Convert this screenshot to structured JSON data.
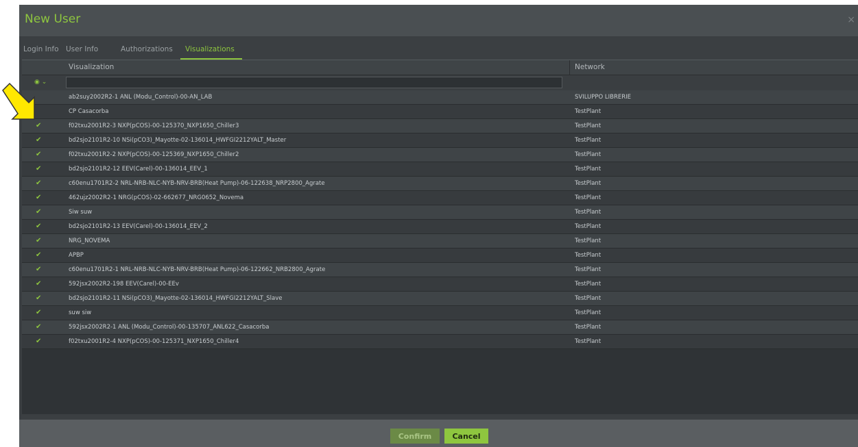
{
  "dialog": {
    "title": "New User"
  },
  "tabs": [
    {
      "label": "Login Info"
    },
    {
      "label": "User Info"
    },
    {
      "label": "Authorizations"
    },
    {
      "label": "Visualizations"
    }
  ],
  "grid": {
    "columns": {
      "visualization": "Visualization",
      "network": "Network"
    },
    "filter": {
      "value": ""
    },
    "rows": [
      {
        "checked": false,
        "visualization": "ab2suy2002R2-1 ANL (Modu_Control)-00-AN_LAB",
        "network": "SVILUPPO LIBRERIE"
      },
      {
        "checked": false,
        "visualization": "CP Casacorba",
        "network": "TestPlant"
      },
      {
        "checked": true,
        "visualization": "f02txu2001R2-3 NXP(pCOS)-00-125370_NXP1650_Chiller3",
        "network": "TestPlant"
      },
      {
        "checked": true,
        "visualization": "bd2sjo2101R2-10 NSi(pCO3)_Mayotte-02-136014_HWFGI2212YALT_Master",
        "network": "TestPlant"
      },
      {
        "checked": true,
        "visualization": "f02txu2001R2-2 NXP(pCOS)-00-125369_NXP1650_Chiller2",
        "network": "TestPlant"
      },
      {
        "checked": true,
        "visualization": "bd2sjo2101R2-12 EEV(Carel)-00-136014_EEV_1",
        "network": "TestPlant"
      },
      {
        "checked": true,
        "visualization": "c60enu1701R2-2 NRL-NRB-NLC-NYB-NRV-BRB(Heat Pump)-06-122638_NRP2800_Agrate",
        "network": "TestPlant"
      },
      {
        "checked": true,
        "visualization": "462ujz2002R2-1 NRG(pCOS)-02-662677_NRG0652_Novema",
        "network": "TestPlant"
      },
      {
        "checked": true,
        "visualization": "Siw suw",
        "network": "TestPlant"
      },
      {
        "checked": true,
        "visualization": "bd2sjo2101R2-13 EEV(Carel)-00-136014_EEV_2",
        "network": "TestPlant"
      },
      {
        "checked": true,
        "visualization": "NRG_NOVEMA",
        "network": "TestPlant"
      },
      {
        "checked": true,
        "visualization": "APBP",
        "network": "TestPlant"
      },
      {
        "checked": true,
        "visualization": "c60enu1701R2-1 NRL-NRB-NLC-NYB-NRV-BRB(Heat Pump)-06-122662_NRB2800_Agrate",
        "network": "TestPlant"
      },
      {
        "checked": true,
        "visualization": "592jsx2002R2-198 EEV(Carel)-00-EEv",
        "network": "TestPlant"
      },
      {
        "checked": true,
        "visualization": "bd2sjo2101R2-11 NSi(pCO3)_Mayotte-02-136014_HWFGI2212YALT_Slave",
        "network": "TestPlant"
      },
      {
        "checked": true,
        "visualization": "suw siw",
        "network": "TestPlant"
      },
      {
        "checked": true,
        "visualization": "592jsx2002R2-1 ANL (Modu_Control)-00-135707_ANL622_Casacorba",
        "network": "TestPlant"
      },
      {
        "checked": true,
        "visualization": "f02txu2001R2-4 NXP(pCOS)-00-125371_NXP1650_Chiller4",
        "network": "TestPlant"
      }
    ]
  },
  "footer": {
    "confirm_label": "Confirm",
    "cancel_label": "Cancel"
  },
  "colors": {
    "accent": "#8ec63f",
    "arrow": "#ffe800"
  }
}
